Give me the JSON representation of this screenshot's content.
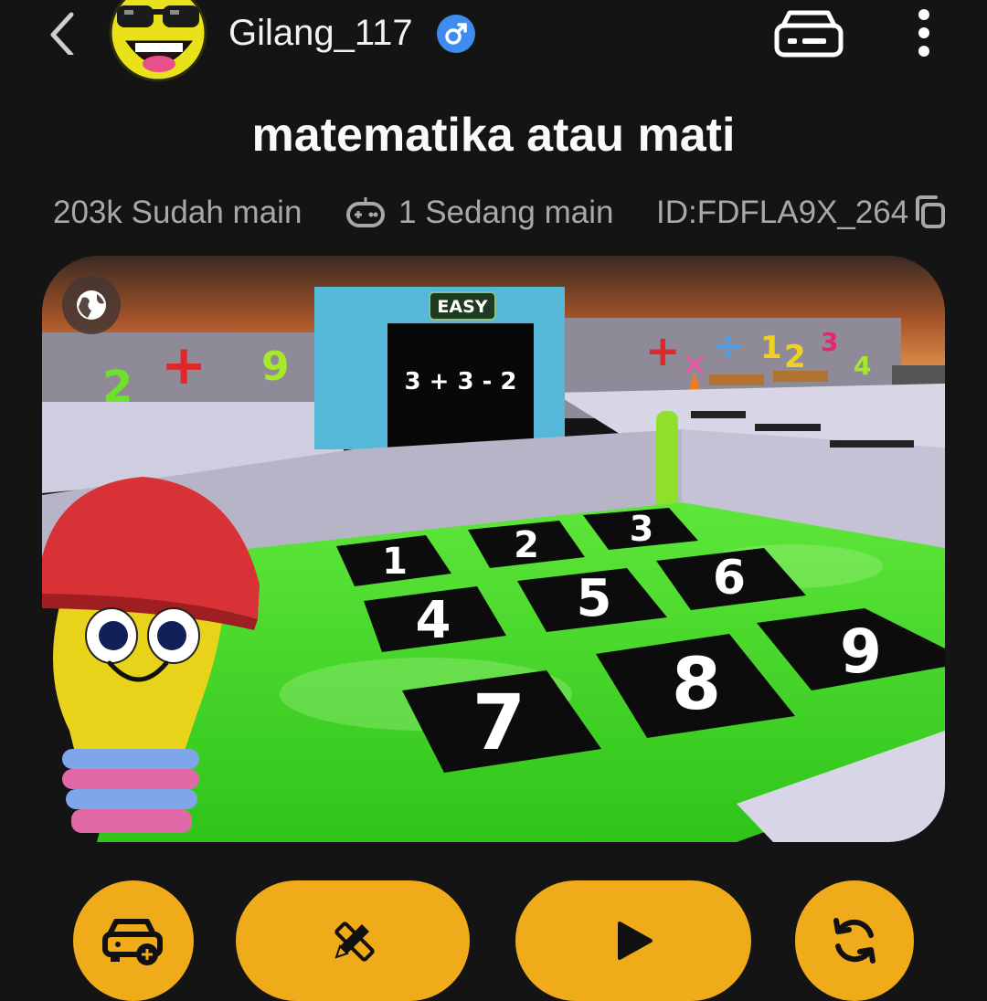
{
  "header": {
    "back_icon": "chevron-left-icon",
    "username": "Gilang_117",
    "gender_symbol": "♂",
    "gender_color": "#3f8cf0",
    "wallet_icon": "wallet-card-icon",
    "more_icon": "more-vertical-icon"
  },
  "game": {
    "title": "matematika atau mati",
    "played": "203k Sudah main",
    "playing": "1 Sedang main",
    "id": "ID:FDFLA9X_264"
  },
  "banner": {
    "difficulty": "EASY",
    "equation": "3 + 3 - 2",
    "tiles": [
      "1",
      "2",
      "3",
      "4",
      "5",
      "6",
      "7",
      "8",
      "9"
    ],
    "wall_symbols": [
      "2",
      "+",
      "9",
      "+",
      "×",
      "÷",
      "1",
      "2",
      "3",
      "4"
    ]
  },
  "actions": {
    "car_icon": "car-add-icon",
    "edit_icon": "pencil-ruler-icon",
    "play_icon": "play-icon",
    "refresh_icon": "refresh-icon",
    "accent": "#efab1a"
  }
}
